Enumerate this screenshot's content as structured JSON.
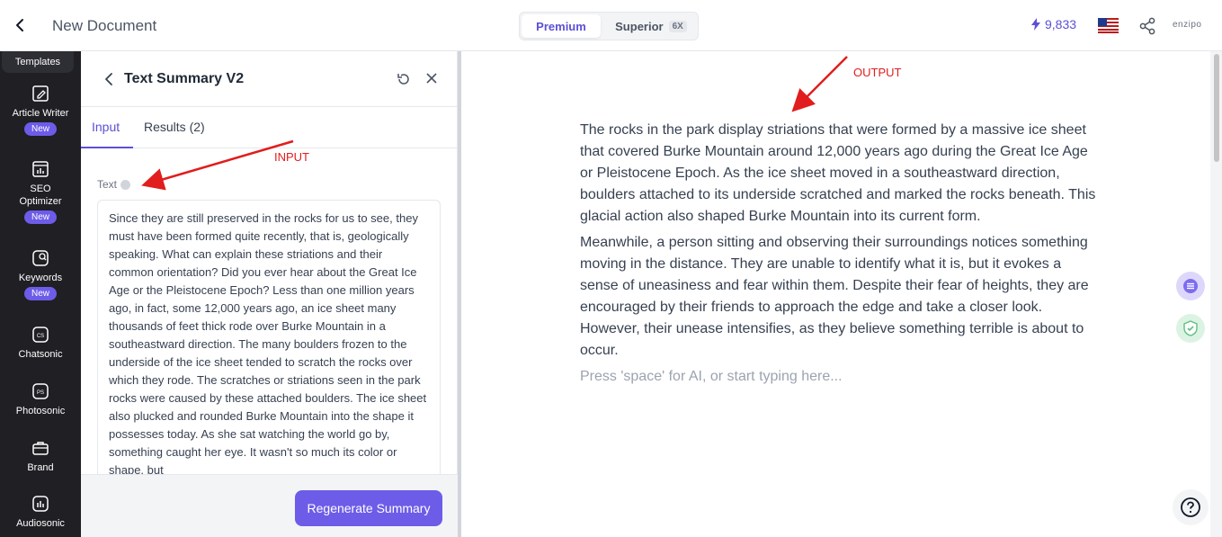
{
  "header": {
    "doc_title": "New Document",
    "plan_premium": "Premium",
    "plan_superior": "Superior",
    "plan_superior_badge": "6X",
    "credits": "9,833",
    "brand_logo": "enzipo"
  },
  "sidebar": {
    "top_item": "Templates",
    "items": [
      {
        "label": "Article Writer",
        "badge": "New"
      },
      {
        "label": "SEO Optimizer",
        "badge": "New"
      },
      {
        "label": "Keywords",
        "badge": "New"
      },
      {
        "label": "Chatsonic",
        "icon_text": "CS"
      },
      {
        "label": "Photosonic",
        "icon_text": "PS"
      },
      {
        "label": "Brand"
      },
      {
        "label": "Audiosonic"
      }
    ]
  },
  "panel": {
    "title": "Text Summary V2",
    "tab_input": "Input",
    "tab_results": "Results (2)",
    "field_label": "Text",
    "input_text": "Since they are still preserved in the rocks for us to see, they must have been formed quite recently, that is, geologically speaking. What can explain these striations and their common orientation? Did you ever hear about the Great Ice Age or the Pleistocene Epoch? Less than one million years ago, in fact, some 12,000 years ago, an ice sheet many thousands of feet thick rode over Burke Mountain in a southeastward direction. The many boulders frozen to the underside of the ice sheet tended to scratch the rocks over which they rode. The scratches or striations seen in the park rocks were caused by these attached boulders. The ice sheet also plucked and rounded Burke Mountain into the shape it possesses today. As she sat watching the world go by, something caught her eye. It wasn't so much its color or shape, but",
    "regenerate_label": "Regenerate Summary"
  },
  "editor": {
    "paragraph1": "The rocks in the park display striations that were formed by a massive ice sheet that covered Burke Mountain around 12,000 years ago during the Great Ice Age or Pleistocene Epoch. As the ice sheet moved in a southeastward direction, boulders attached to its underside scratched and marked the rocks beneath. This glacial action also shaped Burke Mountain into its current form.",
    "paragraph2": "Meanwhile, a person sitting and observing their surroundings notices something moving in the distance. They are unable to identify what it is, but it evokes a sense of uneasiness and fear within them. Despite their fear of heights, they are encouraged by their friends to approach the edge and take a closer look. However, their unease intensifies, as they believe something terrible is about to occur.",
    "placeholder": "Press 'space' for AI, or start typing here..."
  },
  "annotations": {
    "input_label": "INPUT",
    "output_label": "OUTPUT",
    "color": "#e11d1d"
  },
  "colors": {
    "accent": "#6d5ce8",
    "sidebar_bg": "#1f1f24"
  }
}
